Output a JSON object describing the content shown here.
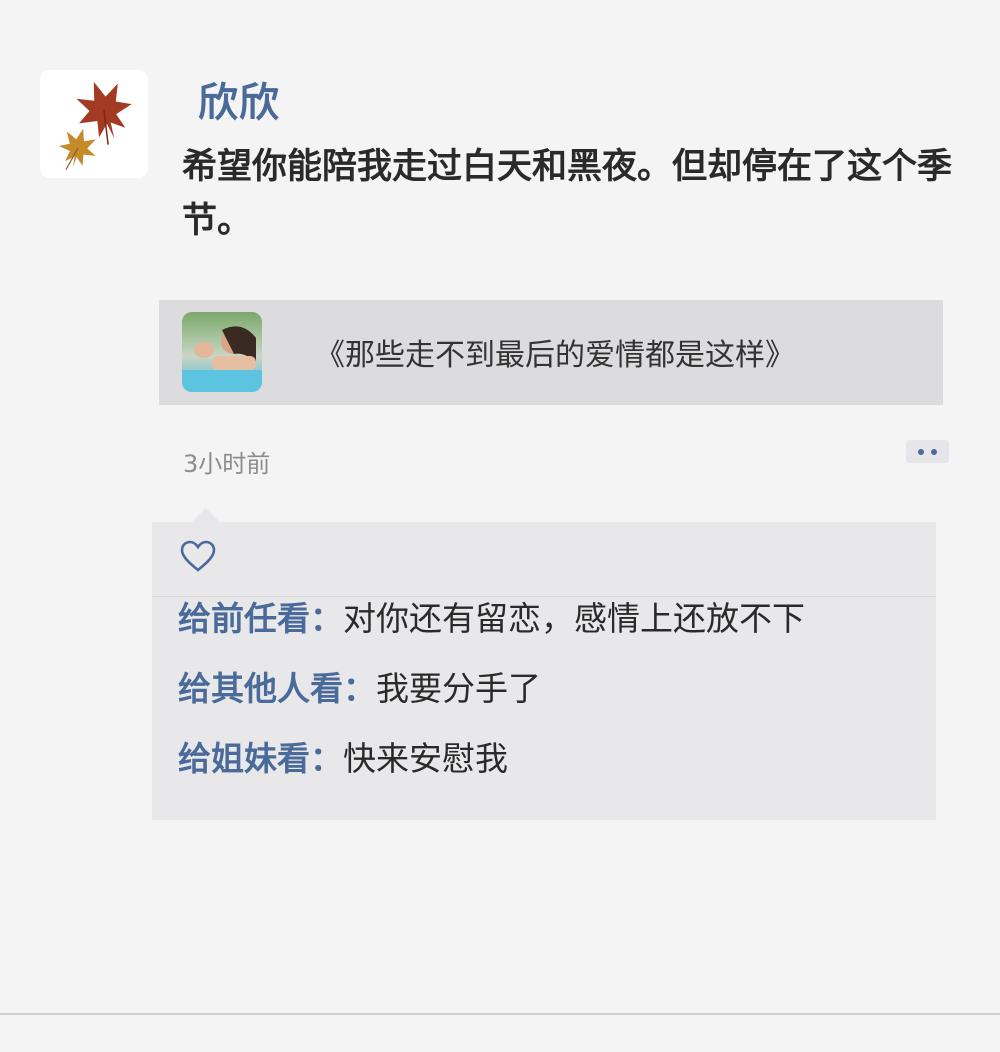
{
  "post": {
    "username": "欣欣",
    "text": "希望你能陪我走过白天和黑夜。但却停在了这个季节。",
    "timestamp": "3小时前"
  },
  "share": {
    "title": "《那些走不到最后的爱情都是这样》"
  },
  "comments": [
    {
      "who": "给前任看：",
      "text": "对你还有留恋，感情上还放不下"
    },
    {
      "who": "给其他人看：",
      "text": "我要分手了"
    },
    {
      "who": "给姐妹看：",
      "text": "快来安慰我"
    }
  ],
  "icons": {
    "avatar": "maple-leaves-icon",
    "more": "more-dots-icon",
    "like": "heart-icon"
  },
  "colors": {
    "accent": "#4a6a9a",
    "background": "#f4f4f4",
    "card": "#dcdbde",
    "comment_box": "#e8e8ea"
  }
}
